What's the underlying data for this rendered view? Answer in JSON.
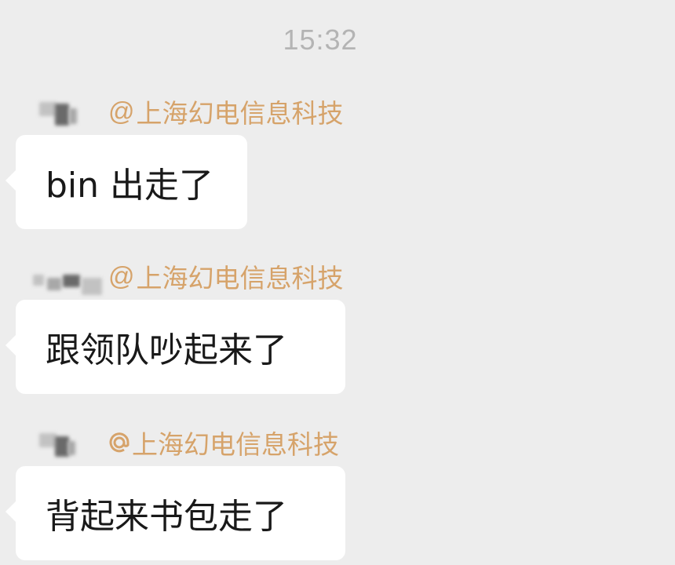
{
  "chat": {
    "timestamp": "15:32",
    "messages": [
      {
        "sender_prefix": "@",
        "sender_name": "上海幻电信息科技",
        "text": "bin 出走了"
      },
      {
        "sender_prefix": "@",
        "sender_name": "上海幻电信息科技",
        "text": "跟领队吵起来了"
      },
      {
        "sender_prefix": "@",
        "sender_name": "上海幻电信息科技",
        "text": "背起来书包走了"
      }
    ]
  },
  "colors": {
    "background": "#ededed",
    "bubble": "#ffffff",
    "sender_name": "#d6a36a",
    "timestamp": "#b4b4b4",
    "message_text": "#191919"
  },
  "icons": {
    "avatar": "pixelated-avatar",
    "mention": "at-sign-icon"
  }
}
